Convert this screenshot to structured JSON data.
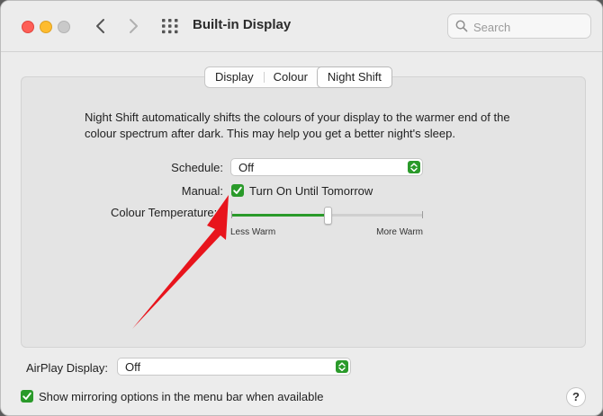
{
  "window": {
    "title": "Built-in Display",
    "search": {
      "placeholder": "Search",
      "value": ""
    }
  },
  "tabs": [
    {
      "label": "Display",
      "active": false
    },
    {
      "label": "Colour",
      "active": false
    },
    {
      "label": "Night Shift",
      "active": true
    }
  ],
  "night_shift": {
    "description": "Night Shift automatically shifts the colours of your display to the warmer end of the colour spectrum after dark. This may help you get a better night's sleep.",
    "schedule": {
      "label": "Schedule:",
      "value": "Off"
    },
    "manual": {
      "label": "Manual:",
      "checkbox_label": "Turn On Until Tomorrow",
      "checked": true
    },
    "colour_temperature": {
      "label": "Colour Temperature:",
      "min_label": "Less Warm",
      "max_label": "More Warm",
      "value_fraction": 0.5
    }
  },
  "airplay": {
    "label": "AirPlay Display:",
    "value": "Off"
  },
  "mirroring": {
    "label": "Show mirroring options in the menu bar when available",
    "checked": true
  },
  "help": {
    "label": "?"
  },
  "colors": {
    "accent": "#2a9a2a",
    "annotation_arrow": "#e8141c"
  }
}
